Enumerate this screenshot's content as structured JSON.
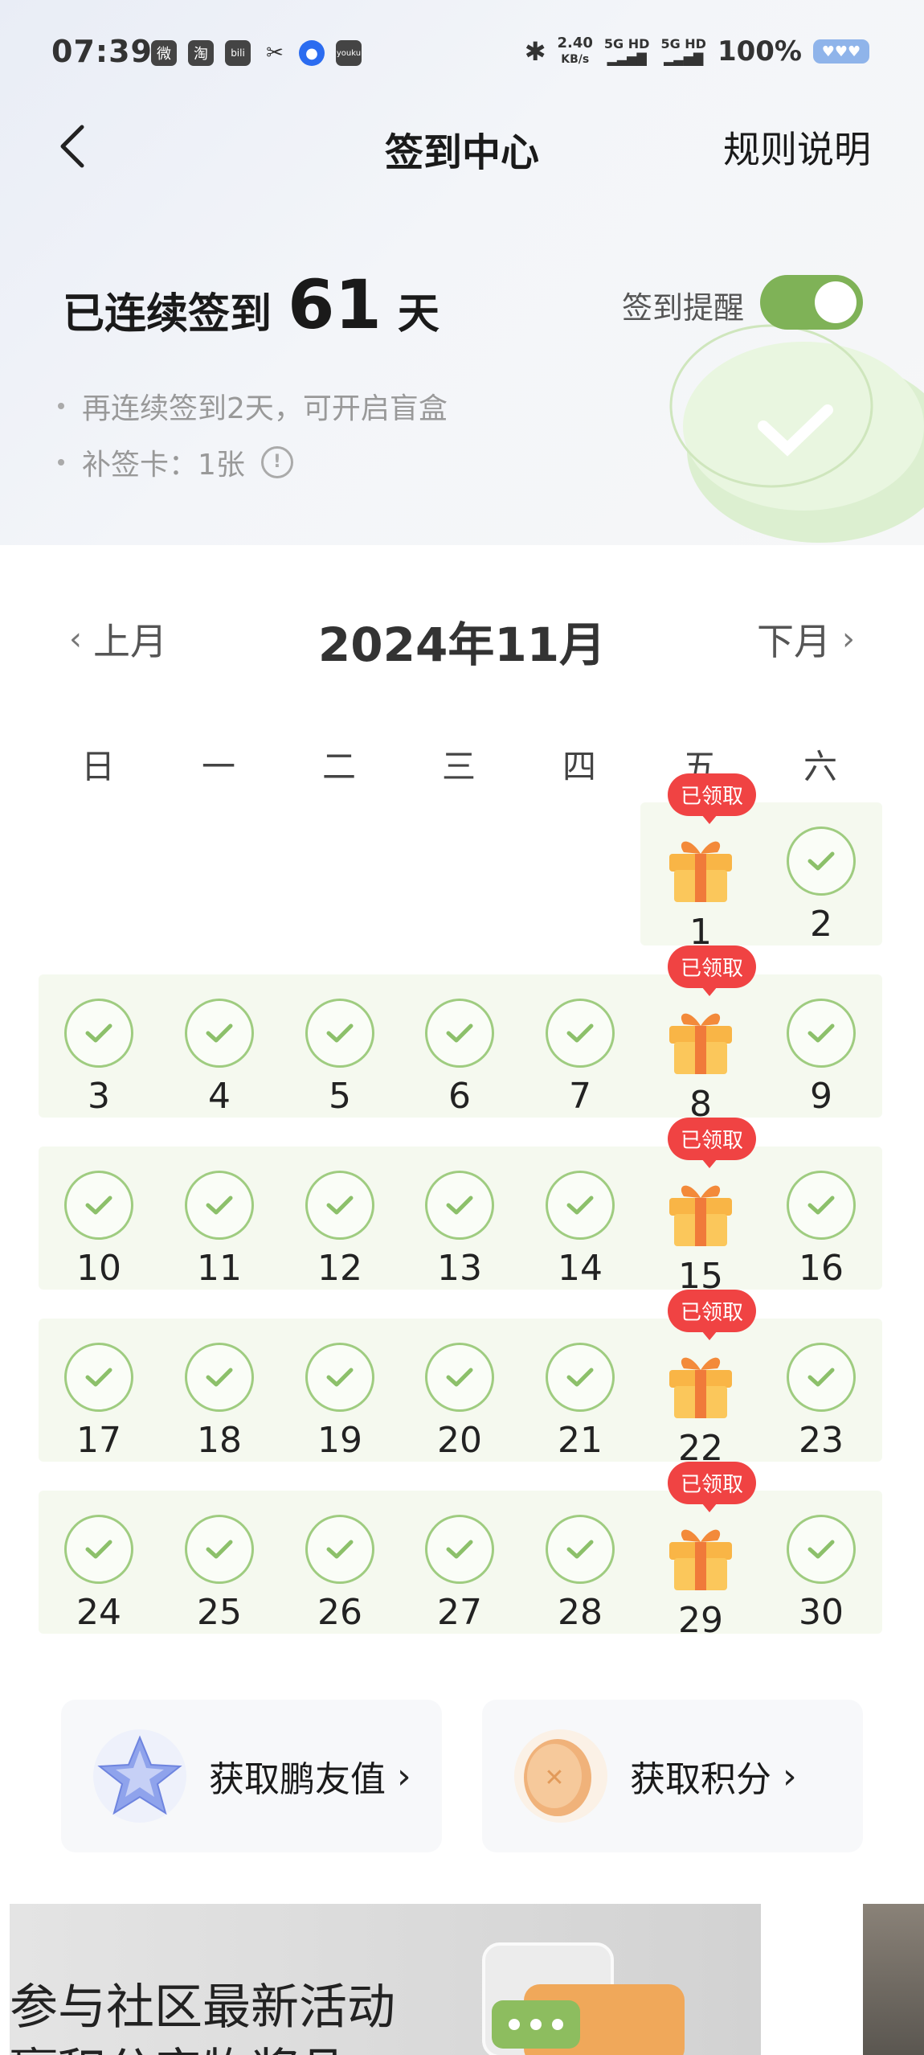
{
  "status_bar": {
    "time": "07:39",
    "apps": [
      "微",
      "淘",
      "bili",
      "✂",
      "●",
      "youku"
    ],
    "net_speed_value": "2.40",
    "net_speed_unit": "KB/s",
    "signal1": "5G HD",
    "signal2": "5G HD",
    "battery": "100%"
  },
  "header": {
    "title": "签到中心",
    "rules": "规则说明"
  },
  "streak": {
    "prefix": "已连续签到",
    "days": "61",
    "unit": "天",
    "tip1": "再连续签到2天，可开启盲盒",
    "tip2": "补签卡：1张",
    "remind_label": "签到提醒",
    "remind_on": true
  },
  "calendar": {
    "prev": "上月",
    "next": "下月",
    "month": "2024年11月",
    "weekdays": [
      "日",
      "一",
      "二",
      "三",
      "四",
      "五",
      "六"
    ],
    "gift_badge": "已领取"
  },
  "actions": {
    "friend_value": "获取鹏友值",
    "points": "获取积分"
  },
  "banner": {
    "line1": "参与社区最新活动",
    "line2": "赢积分实物奖品"
  },
  "colors": {
    "accent_green": "#7fb257",
    "check_green": "#9fcc80",
    "badge_red": "#f04343",
    "gift_orange": "#f7a93c"
  }
}
